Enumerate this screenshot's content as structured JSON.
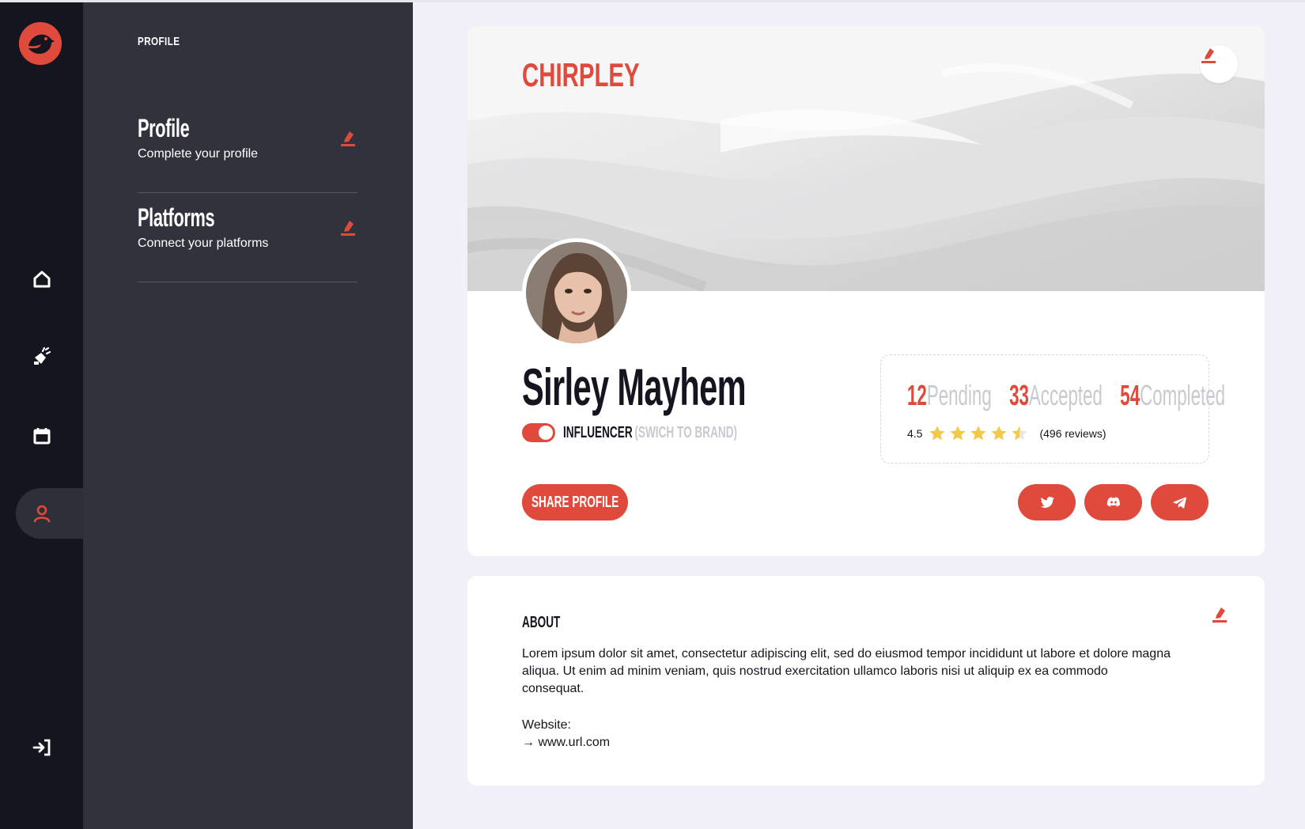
{
  "sidebar": {
    "logo": "chirpley-bird-logo",
    "nav": [
      {
        "icon": "home-icon"
      },
      {
        "icon": "campaigns-icon"
      },
      {
        "icon": "calendar-icon"
      },
      {
        "icon": "user-icon",
        "active": true
      }
    ],
    "logout_icon": "logout-icon"
  },
  "panel": {
    "title": "PROFILE",
    "items": [
      {
        "title": "Profile",
        "subtitle": "Complete your profile",
        "icon": "edit-icon"
      },
      {
        "title": "Platforms",
        "subtitle": "Connect your platforms",
        "icon": "edit-icon"
      }
    ]
  },
  "profile": {
    "brand": "CHIRPLEY",
    "name": "Sirley Mayhem",
    "role": "INFLUENCER",
    "switch_label": "(SWICH TO BRAND)",
    "share_label": "SHARE PROFILE",
    "stats": [
      {
        "value": "12",
        "label": "Pending"
      },
      {
        "value": "33",
        "label": "Accepted"
      },
      {
        "value": "54",
        "label": "Completed"
      }
    ],
    "rating": "4.5",
    "rating_value": 4.5,
    "reviews": "(496 reviews)",
    "socials": [
      "twitter-icon",
      "discord-icon",
      "telegram-icon"
    ]
  },
  "about": {
    "title": "ABOUT",
    "text": "Lorem ipsum dolor sit amet, consectetur adipiscing elit, sed do eiusmod tempor incididunt ut labore et dolore magna aliqua. Ut enim ad minim veniam, quis nostrud exercitation ullamco laboris nisi ut aliquip ex ea commodo consequat.",
    "website_label": "Website:",
    "website_url": "→ www.url.com"
  },
  "colors": {
    "accent": "#e04a3c",
    "rail": "#15151f",
    "panel": "#32323d",
    "background": "#f1f0f8",
    "star": "#f2c94c"
  }
}
